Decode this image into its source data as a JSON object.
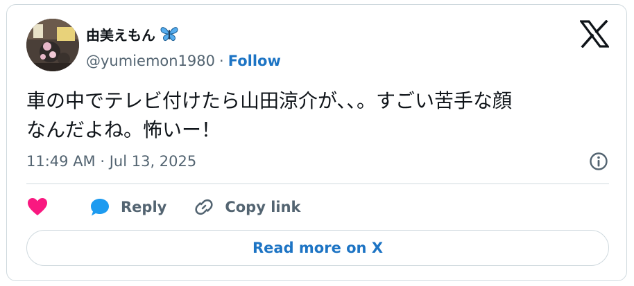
{
  "author": {
    "display_name": "由美えもん",
    "name_emoji_icon": "butterfly-icon",
    "handle": "@yumiemon1980",
    "separator": "·",
    "follow_label": "Follow"
  },
  "tweet": {
    "text_lines": [
      "車の中でテレビ付けたら山田涼介が､､。すごい苦手な顔",
      "なんだよね。怖いー！"
    ],
    "timestamp": "11:49 AM · Jul 13, 2025"
  },
  "actions": {
    "like_icon": "heart-icon",
    "reply_label": "Reply",
    "copy_link_label": "Copy link"
  },
  "read_more_label": "Read more on X",
  "colors": {
    "link_blue": "#1d74c4",
    "heart_pink": "#f91880",
    "reply_blue": "#1d9bf0",
    "text_dark": "#0f1419",
    "text_gray": "#536471",
    "border": "#cfd9de"
  }
}
